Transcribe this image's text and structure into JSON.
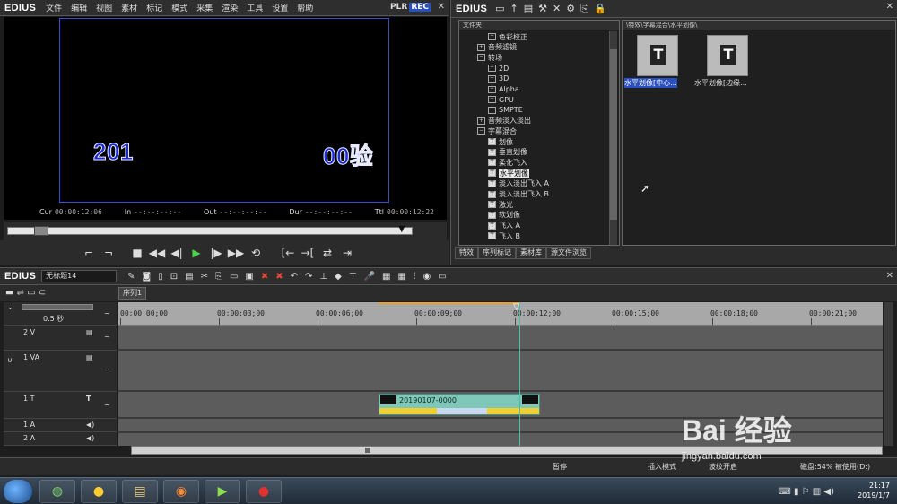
{
  "menubar": {
    "logo": "EDIUS",
    "items": [
      "文件",
      "编辑",
      "视图",
      "素材",
      "标记",
      "模式",
      "采集",
      "渲染",
      "工具",
      "设置",
      "帮助"
    ],
    "plr": "PLR",
    "rec": "REC"
  },
  "preview": {
    "text_left": "201",
    "text_right": "00验",
    "cur_label": "Cur",
    "cur_value": "00:00:12:06",
    "in_label": "In",
    "in_value": "--:--:--:--",
    "out_label": "Out",
    "out_value": "--:--:--:--",
    "dur_label": "Dur",
    "dur_value": "--:--:--:--",
    "ttl_label": "Ttl",
    "ttl_value": "00:00:12:22"
  },
  "right_panel": {
    "logo": "EDIUS",
    "folder_pane_title": "文件夹",
    "path": "\\特效\\字幕混合\\水平划像\\",
    "tree": [
      {
        "label": "色彩校正",
        "indent": 2,
        "icon": "folder"
      },
      {
        "label": "音频滤镜",
        "indent": 1,
        "icon": "folder"
      },
      {
        "label": "转场",
        "indent": 1,
        "icon": "folder-open"
      },
      {
        "label": "2D",
        "indent": 2,
        "icon": "folder"
      },
      {
        "label": "3D",
        "indent": 2,
        "icon": "folder"
      },
      {
        "label": "Alpha",
        "indent": 2,
        "icon": "folder"
      },
      {
        "label": "GPU",
        "indent": 2,
        "icon": "folder"
      },
      {
        "label": "SMPTE",
        "indent": 2,
        "icon": "folder"
      },
      {
        "label": "音频淡入淡出",
        "indent": 1,
        "icon": "folder"
      },
      {
        "label": "字幕混合",
        "indent": 1,
        "icon": "folder-open"
      },
      {
        "label": "划像",
        "indent": 2,
        "icon": "t"
      },
      {
        "label": "垂直划像",
        "indent": 2,
        "icon": "t"
      },
      {
        "label": "柔化飞入",
        "indent": 2,
        "icon": "t"
      },
      {
        "label": "水平划像",
        "indent": 2,
        "icon": "t",
        "selected": true
      },
      {
        "label": "淡入淡出飞入 A",
        "indent": 2,
        "icon": "t"
      },
      {
        "label": "淡入淡出飞入 B",
        "indent": 2,
        "icon": "t"
      },
      {
        "label": "激光",
        "indent": 2,
        "icon": "t"
      },
      {
        "label": "软划像",
        "indent": 2,
        "icon": "t"
      },
      {
        "label": "飞入 A",
        "indent": 2,
        "icon": "t"
      },
      {
        "label": "飞入 B",
        "indent": 2,
        "icon": "t"
      }
    ],
    "thumbs": [
      {
        "label": "水平划像[中心...",
        "selected": true
      },
      {
        "label": "水平划像[边缘..."
      }
    ],
    "tabs": [
      "特效",
      "序列标记",
      "素材库",
      "源文件浏览"
    ]
  },
  "timeline": {
    "logo": "EDIUS",
    "project_name": "无标题14",
    "sequence_tab": "序列1",
    "zoom": "0.5 秒",
    "ruler": [
      "00:00:00;00",
      "00:00:03;00",
      "00:00:06;00",
      "00:00:09;00",
      "00:00:12;00",
      "00:00:15;00",
      "00:00:18;00",
      "00:00:21;00"
    ],
    "tracks": [
      {
        "name": "2 V",
        "badge": "▤"
      },
      {
        "name": "1 VA",
        "badge": "▤"
      },
      {
        "name": "1 T",
        "badge": "T"
      },
      {
        "name": "1 A",
        "badge": "◀)"
      },
      {
        "name": "2 A",
        "badge": "◀)"
      }
    ],
    "clip_name": "20190107-0000"
  },
  "status": {
    "pause": "暂停",
    "mode": "插入模式",
    "ripple": "波纹开启",
    "disk": "磁盘:54% 被使用(D:)"
  },
  "taskbar": {
    "time": "21:17",
    "date": "2019/1/7"
  },
  "watermark": {
    "text": "Bai 经验",
    "url": "jingyan.baidu.com"
  }
}
